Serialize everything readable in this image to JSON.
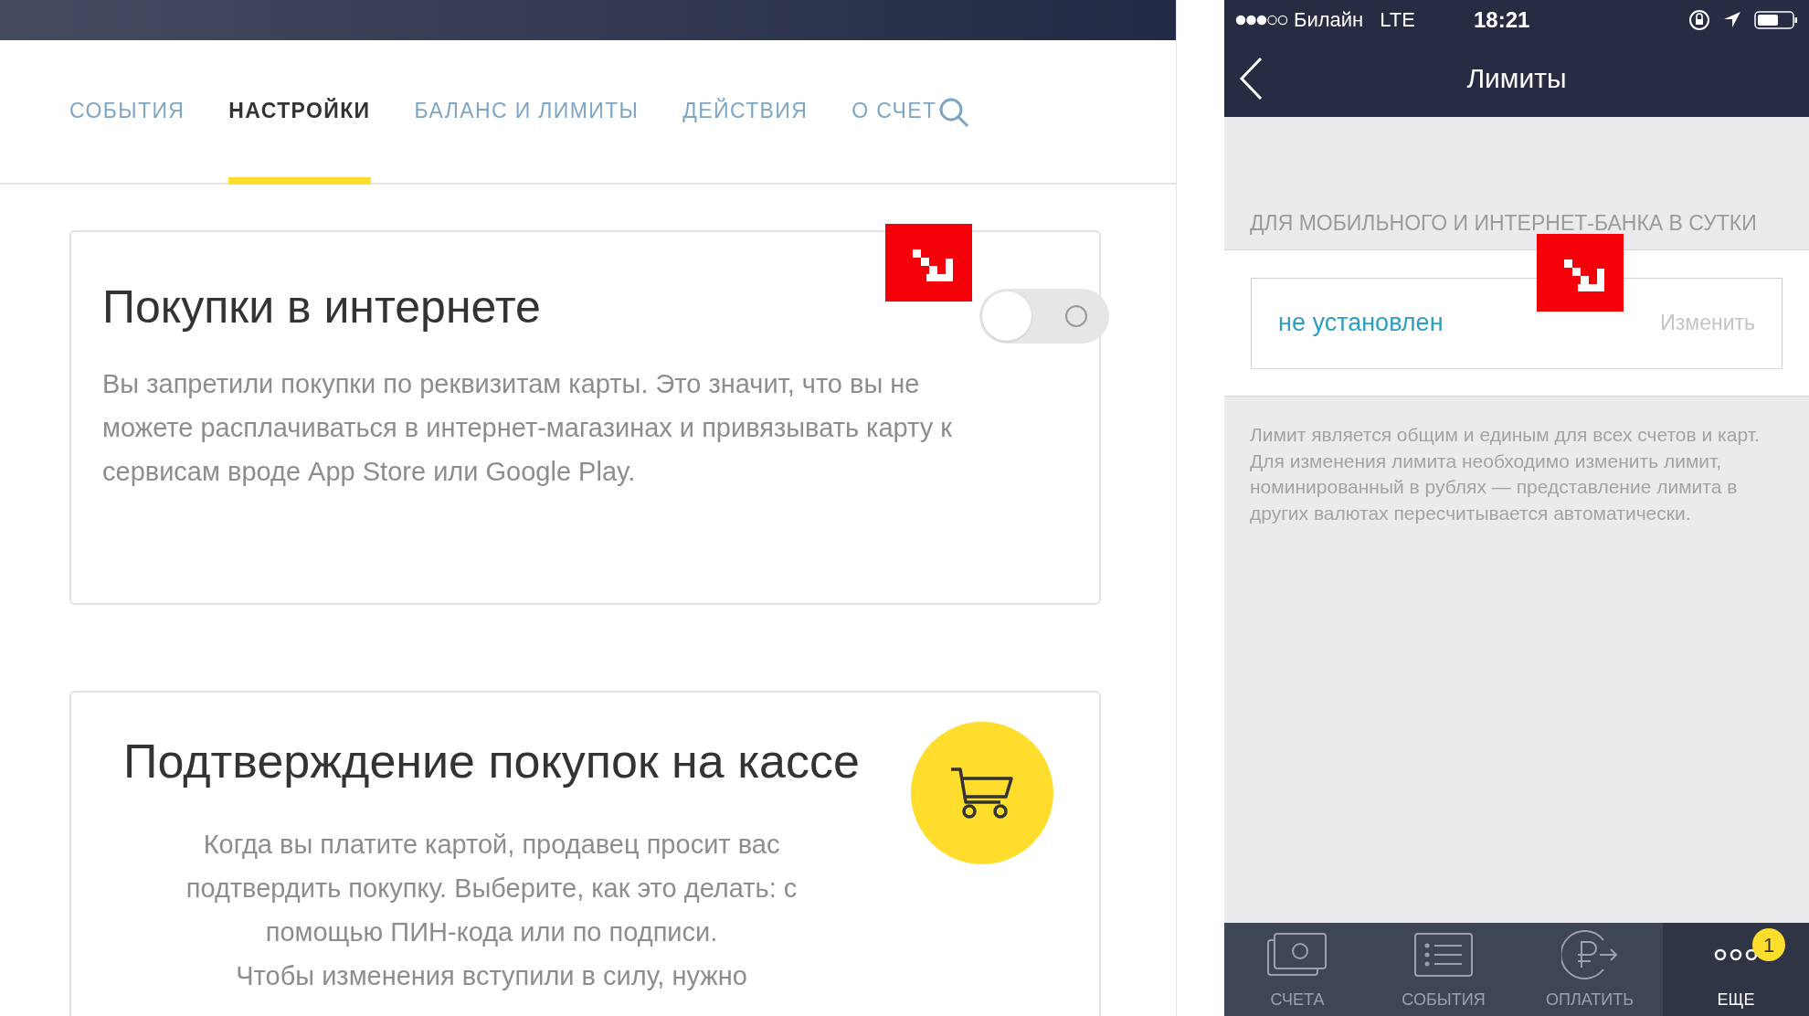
{
  "web": {
    "tabs": [
      {
        "label": "СОБЫТИЯ",
        "selected": false
      },
      {
        "label": "НАСТРОЙКИ",
        "selected": true
      },
      {
        "label": "БАЛАНС И ЛИМИТЫ",
        "selected": false
      },
      {
        "label": "ДЕЙСТВИЯ",
        "selected": false
      },
      {
        "label": "О СЧЕТ",
        "selected": false
      }
    ],
    "cards": [
      {
        "kind": "toggle",
        "title": "Покупки в интернете",
        "on": false,
        "body": [
          "Вы запретили покупки по реквизитам карты. Это значит, что вы не можете расплачиваться в интернет-магазинах и привязывать карту к сервисам вроде App Store или Google Play."
        ]
      },
      {
        "kind": "cart",
        "title": "Подтверждение покупок на кассе",
        "body": [
          "Когда вы платите картой, продавец просит вас подтвердить покупку. Выберите, как это делать: с помощью ПИН-кода или по подписи.",
          "Чтобы изменения вступили в силу, нужно"
        ]
      }
    ]
  },
  "phone": {
    "status_bar": {
      "carrier": "Билайн",
      "network": "LTE",
      "time": "18:21"
    },
    "nav_title": "Лимиты",
    "section_header": "ДЛЯ МОБИЛЬНОГО И ИНТЕРНЕТ-БАНКА В СУТКИ",
    "limit": {
      "value": "не установлен",
      "action": "Изменить"
    },
    "note": [
      "Лимит является общим и единым для всех счетов и карт.",
      "Для изменения лимита необходимо изменить лимит, номинированный в рублях — представление лимита в других валютах пересчитывается автоматически."
    ],
    "tab_bar": [
      {
        "kind": "accounts",
        "label": "СЧЕТА",
        "selected": false
      },
      {
        "kind": "events",
        "label": "СОБЫТИЯ",
        "selected": false
      },
      {
        "kind": "pay",
        "label": "ОПЛАТИТЬ",
        "selected": false
      },
      {
        "kind": "more",
        "label": "ЕЩЕ",
        "selected": true,
        "badge": "1"
      }
    ]
  }
}
